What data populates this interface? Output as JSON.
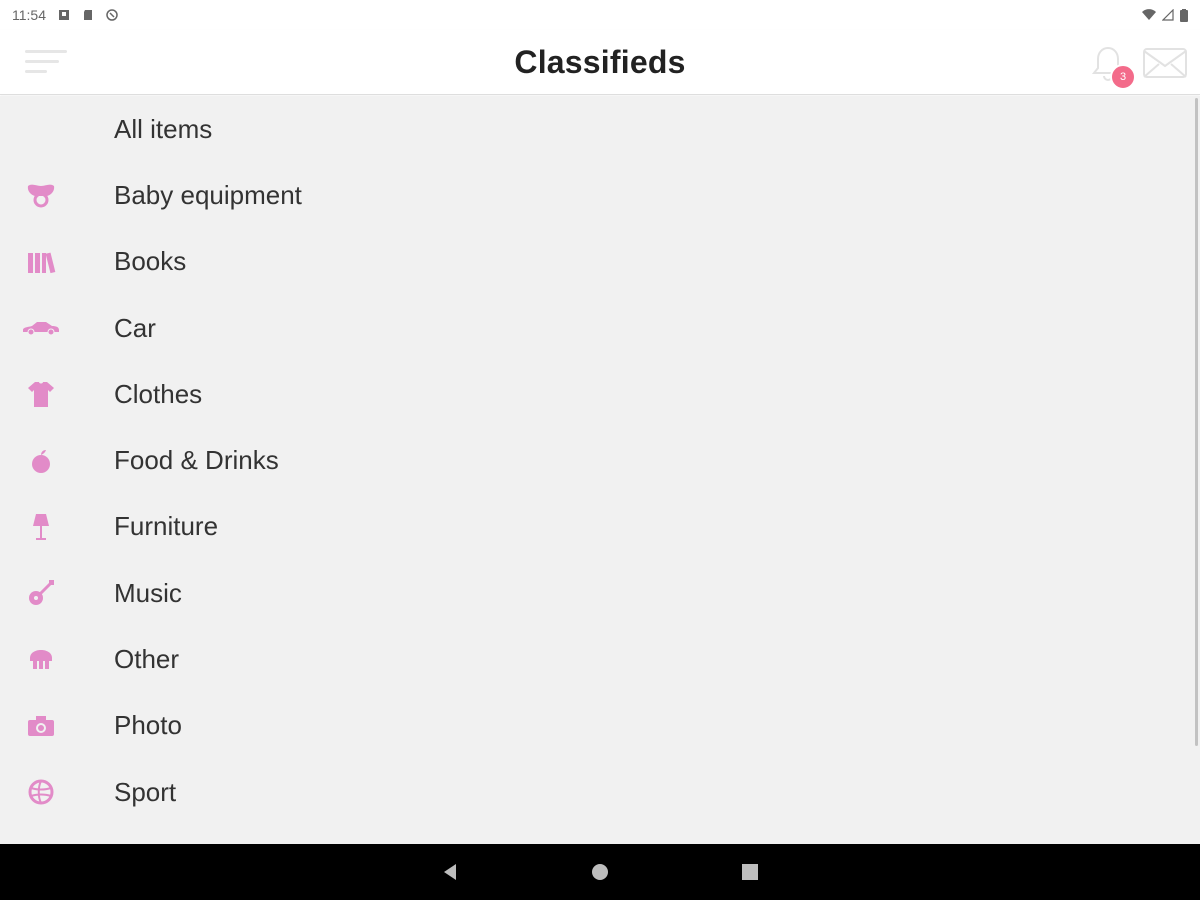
{
  "status_bar": {
    "time": "11:54",
    "left_icons": [
      "notification-icon",
      "sd-card-icon",
      "sync-icon"
    ],
    "right_icons": [
      "wifi-icon",
      "cellular-icon",
      "battery-icon"
    ]
  },
  "header": {
    "title": "Classifieds",
    "notification_count": "3",
    "icons": [
      "menu-icon",
      "bell-icon",
      "mail-icon"
    ]
  },
  "colors": {
    "accent_pink": "#e28bc8",
    "badge": "#f36b8a",
    "list_background": "#f1f1f1"
  },
  "categories": [
    {
      "label": "All items",
      "icon": ""
    },
    {
      "label": "Baby equipment",
      "icon": "pacifier-icon"
    },
    {
      "label": "Books",
      "icon": "books-icon"
    },
    {
      "label": "Car",
      "icon": "car-icon"
    },
    {
      "label": "Clothes",
      "icon": "tshirt-icon"
    },
    {
      "label": "Food & Drinks",
      "icon": "apple-icon"
    },
    {
      "label": "Furniture",
      "icon": "lamp-icon"
    },
    {
      "label": "Music",
      "icon": "guitar-icon"
    },
    {
      "label": "Other",
      "icon": "other-icon"
    },
    {
      "label": "Photo",
      "icon": "camera-icon"
    },
    {
      "label": "Sport",
      "icon": "ball-icon"
    }
  ],
  "nav_bar": {
    "icons": [
      "back-icon",
      "home-icon",
      "recents-icon"
    ]
  }
}
